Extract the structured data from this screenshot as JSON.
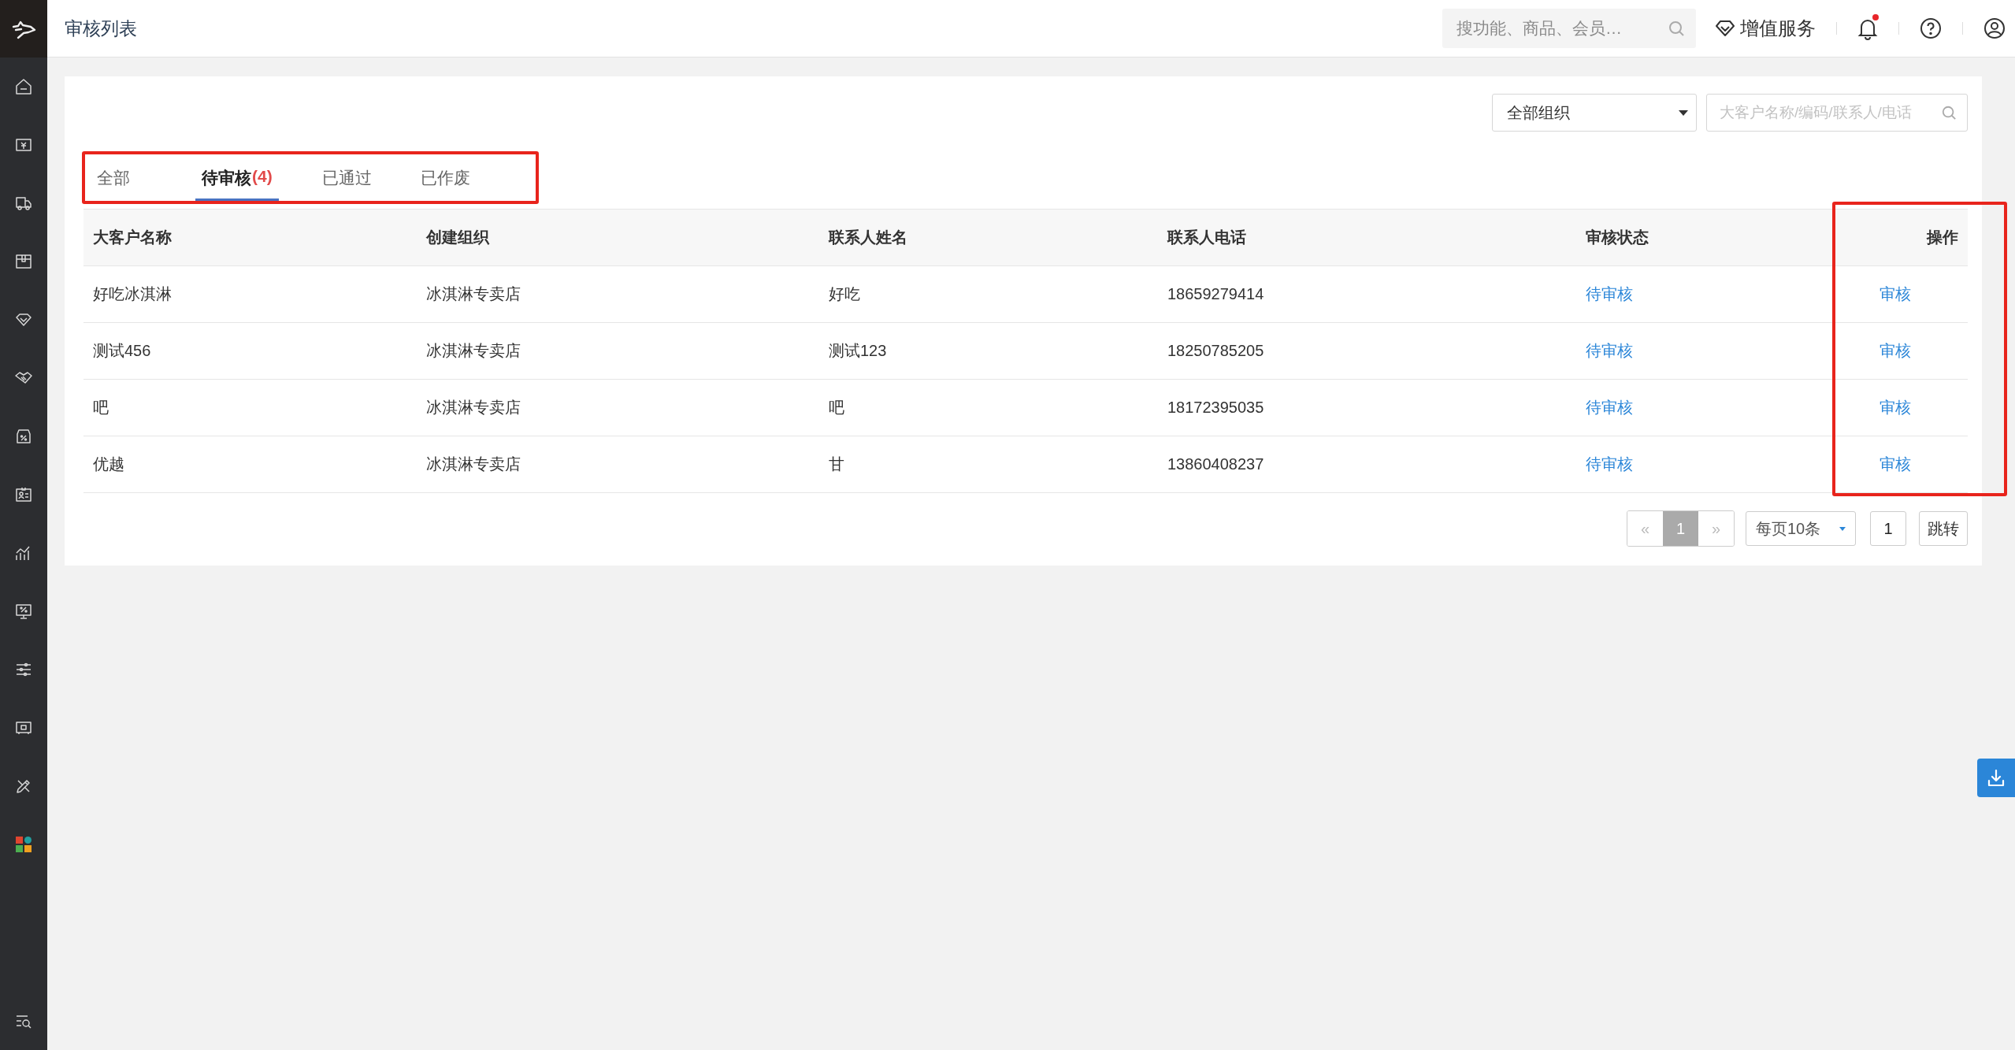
{
  "header": {
    "title": "审核列表",
    "search": {
      "placeholder": "搜功能、商品、会员…"
    },
    "value_added": "增值服务",
    "notification_dot": true
  },
  "sidebar": {
    "items": [
      {
        "kind": "home"
      },
      {
        "kind": "money"
      },
      {
        "kind": "truck"
      },
      {
        "kind": "box"
      },
      {
        "kind": "diamond"
      },
      {
        "kind": "handshake"
      },
      {
        "kind": "ticket"
      },
      {
        "kind": "card"
      },
      {
        "kind": "chart"
      },
      {
        "kind": "monitor"
      },
      {
        "kind": "sliders"
      },
      {
        "kind": "device"
      },
      {
        "kind": "tools"
      },
      {
        "kind": "apps"
      }
    ],
    "bottom": {
      "kind": "search-list"
    }
  },
  "filters": {
    "organization": "全部组织",
    "search": {
      "placeholder": "大客户名称/编码/联系人/电话"
    }
  },
  "tabs": {
    "highlighted": true,
    "items": [
      {
        "label": "全部",
        "selected": false
      },
      {
        "label": "待审核",
        "count": "(4)",
        "selected": true
      },
      {
        "label": "已通过",
        "selected": false
      },
      {
        "label": "已作废",
        "selected": false
      }
    ]
  },
  "table": {
    "action_column_highlighted": true,
    "columns": [
      "大客户名称",
      "创建组织",
      "联系人姓名",
      "联系人电话",
      "审核状态",
      "操作"
    ],
    "rows": [
      {
        "name": "好吃冰淇淋",
        "org": "冰淇淋专卖店",
        "contact": "好吃",
        "phone": "18659279414",
        "status": "待审核",
        "action": "审核"
      },
      {
        "name": "测试456",
        "org": "冰淇淋专卖店",
        "contact": "测试123",
        "phone": "18250785205",
        "status": "待审核",
        "action": "审核"
      },
      {
        "name": "吧",
        "org": "冰淇淋专卖店",
        "contact": "吧",
        "phone": "18172395035",
        "status": "待审核",
        "action": "审核"
      },
      {
        "name": "优越",
        "org": "冰淇淋专卖店",
        "contact": "甘",
        "phone": "13860408237",
        "status": "待审核",
        "action": "审核"
      }
    ]
  },
  "pagination": {
    "prev": "«",
    "pages": [
      {
        "label": "1",
        "selected": true
      }
    ],
    "next": "»",
    "page_size": "每页10条",
    "jump_value": "1",
    "jump_button": "跳转"
  }
}
